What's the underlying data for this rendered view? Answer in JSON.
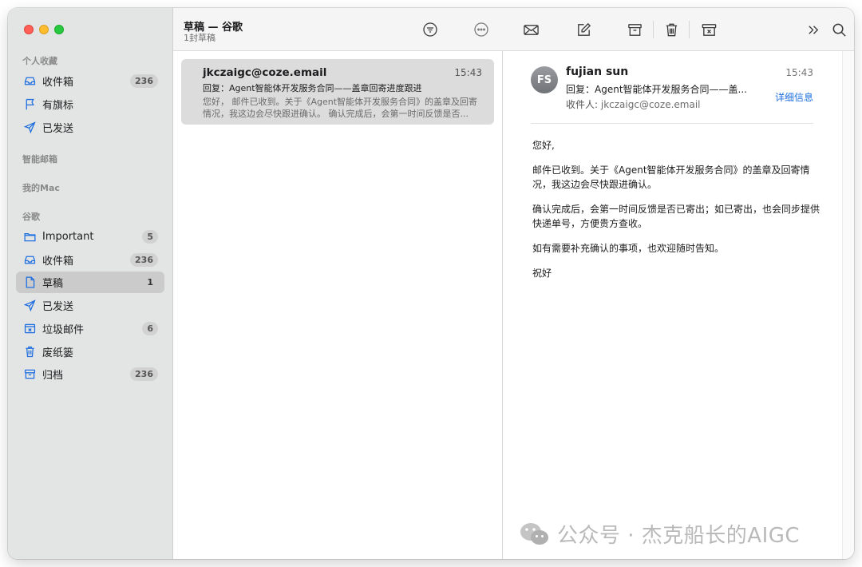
{
  "window": {
    "traffic_lights": {
      "close": "#fe5f57",
      "minimize": "#febc2e",
      "zoom": "#28c840"
    }
  },
  "sidebar": {
    "favorites_title": "个人收藏",
    "favorites": [
      {
        "label": "收件箱",
        "badge": "236",
        "icon": "inbox-icon"
      },
      {
        "label": "有旗标",
        "badge": "",
        "icon": "flag-icon"
      },
      {
        "label": "已发送",
        "badge": "",
        "icon": "sent-icon"
      }
    ],
    "smart_title": "智能邮箱",
    "mac_title": "我的Mac",
    "account_title": "谷歌",
    "account_items": [
      {
        "label": "Important",
        "badge": "5",
        "icon": "folder-icon"
      },
      {
        "label": "收件箱",
        "badge": "236",
        "icon": "inbox-icon"
      },
      {
        "label": "草稿",
        "badge": "1",
        "icon": "draft-icon",
        "selected": true
      },
      {
        "label": "已发送",
        "badge": "",
        "icon": "sent-icon"
      },
      {
        "label": "垃圾邮件",
        "badge": "6",
        "icon": "junk-icon"
      },
      {
        "label": "废纸篓",
        "badge": "",
        "icon": "trash-icon"
      },
      {
        "label": "归档",
        "badge": "236",
        "icon": "archive-icon"
      }
    ],
    "accent_color": "#1f6fe0"
  },
  "message_list": {
    "title": "草稿 — 谷歌",
    "subtitle": "1封草稿",
    "messages": [
      {
        "from": "jkczaigc@coze.email",
        "time": "15:43",
        "subject": "回复：Agent智能体开发服务合同——盖章回寄进度跟进",
        "preview": "您好， 邮件已收到。关于《Agent智能体开发服务合同》的盖章及回寄情况，我这边会尽快跟进确认。 确认完成后，会第一时间反馈是否..."
      }
    ]
  },
  "reader": {
    "avatar_initials": "FS",
    "sender": "fujian sun",
    "time": "15:43",
    "subject": "回复：Agent智能体开发服务合同——盖...",
    "to_label": "收件人:",
    "to_value": "jkczaigc@coze.email",
    "details_link": "详细信息",
    "body": [
      "您好,",
      "邮件已收到。关于《Agent智能体开发服务合同》的盖章及回寄情况，我这边会尽快跟进确认。",
      "确认完成后，会第一时间反馈是否已寄出；如已寄出，也会同步提供快递单号，方便贵方查收。",
      "如有需要补充确认的事项，也欢迎随时告知。",
      "祝好"
    ]
  },
  "watermark": {
    "text": "公众号 · 杰克船长的AIGC",
    "icon": "wechat-icon"
  }
}
